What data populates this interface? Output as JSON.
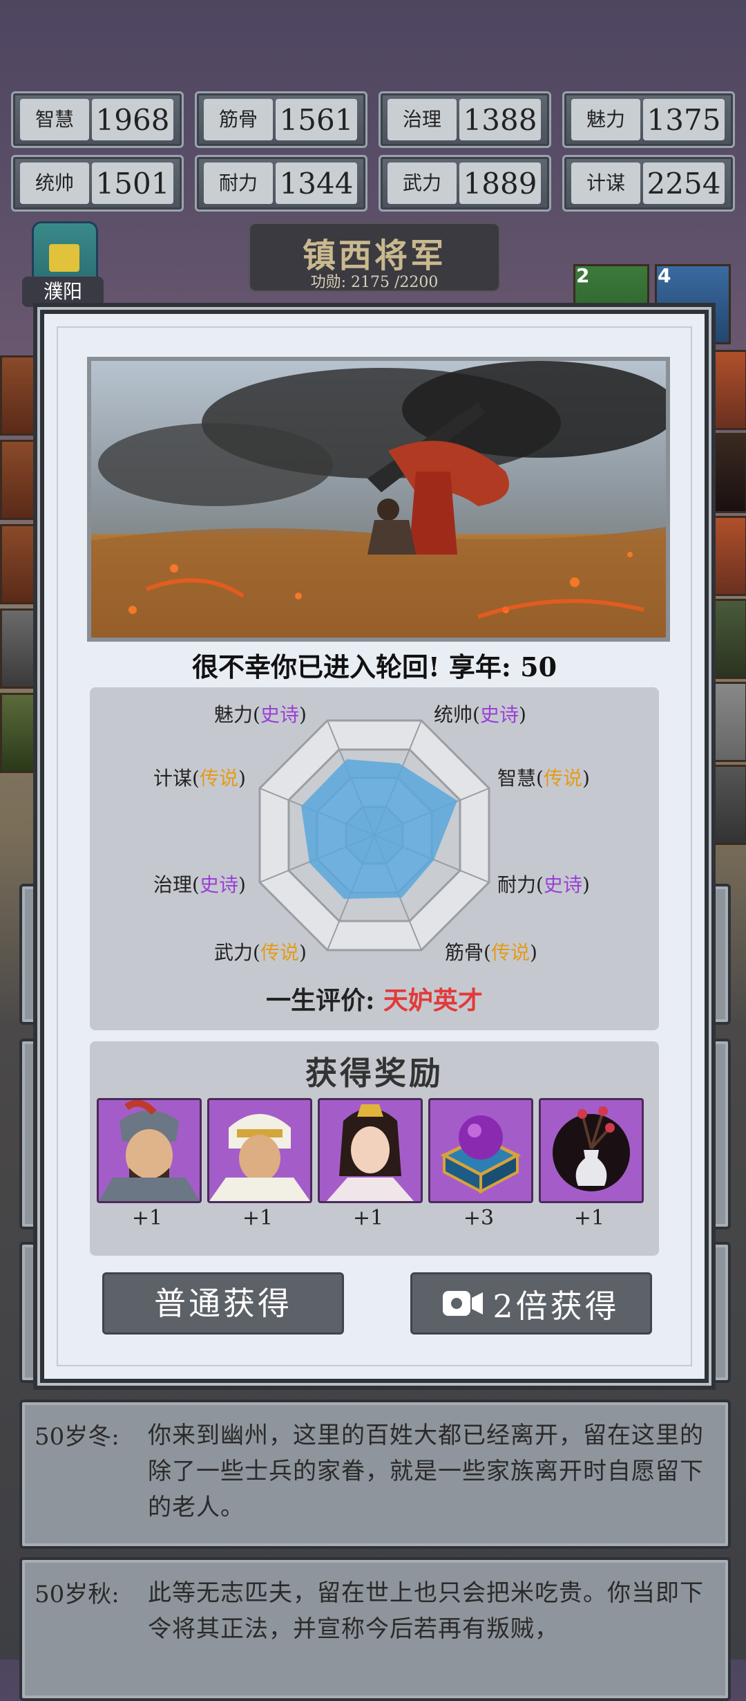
{
  "stats": [
    {
      "label": "智慧",
      "value": "1968"
    },
    {
      "label": "筋骨",
      "value": "1561"
    },
    {
      "label": "治理",
      "value": "1388"
    },
    {
      "label": "魅力",
      "value": "1375"
    },
    {
      "label": "统帅",
      "value": "1501"
    },
    {
      "label": "耐力",
      "value": "1344"
    },
    {
      "label": "武力",
      "value": "1889"
    },
    {
      "label": "计谋",
      "value": "2254"
    }
  ],
  "title": {
    "rank": "镇西将军",
    "merit": "功勋: 2175 /2200"
  },
  "city": {
    "name": "濮阳"
  },
  "side_badges": [
    "2",
    "4"
  ],
  "modal": {
    "death_text": "很不幸你已进入轮回! 享年: 50",
    "radar": {
      "labels": [
        {
          "name": "魅力",
          "grade": "史诗"
        },
        {
          "name": "统帅",
          "grade": "史诗"
        },
        {
          "name": "智慧",
          "grade": "传说"
        },
        {
          "name": "耐力",
          "grade": "史诗"
        },
        {
          "name": "筋骨",
          "grade": "传说"
        },
        {
          "name": "武力",
          "grade": "传说"
        },
        {
          "name": "治理",
          "grade": "史诗"
        },
        {
          "name": "计谋",
          "grade": "传说"
        }
      ]
    },
    "evaluation_label": "一生评价:",
    "evaluation_value": "天妒英才",
    "reward_title": "获得奖励",
    "rewards": [
      {
        "icon": "general-portrait-warrior",
        "count": "+1"
      },
      {
        "icon": "general-portrait-turban",
        "count": "+1"
      },
      {
        "icon": "general-portrait-lady",
        "count": "+1"
      },
      {
        "icon": "orb-chest-icon",
        "count": "+3"
      },
      {
        "icon": "vase-icon",
        "count": "+1"
      }
    ],
    "btn_normal": "普通获得",
    "btn_double": "2倍获得"
  },
  "log": [
    {
      "age": "50岁冬:",
      "text": "你来到幽州，这里的百姓大都已经离开，留在这里的除了一些士兵的家眷，就是一些家族离开时自愿留下的老人。"
    },
    {
      "age": "50岁秋:",
      "text": "此等无志匹夫，留在世上也只会把米吃贵。你当即下令将其正法，并宣称今后若再有叛贼，"
    }
  ],
  "colors": {
    "epic": "#9a3fd6",
    "legend": "#e59a1a",
    "evaluation": "#e23a3a",
    "radar_fill": "#5aa7dc"
  }
}
